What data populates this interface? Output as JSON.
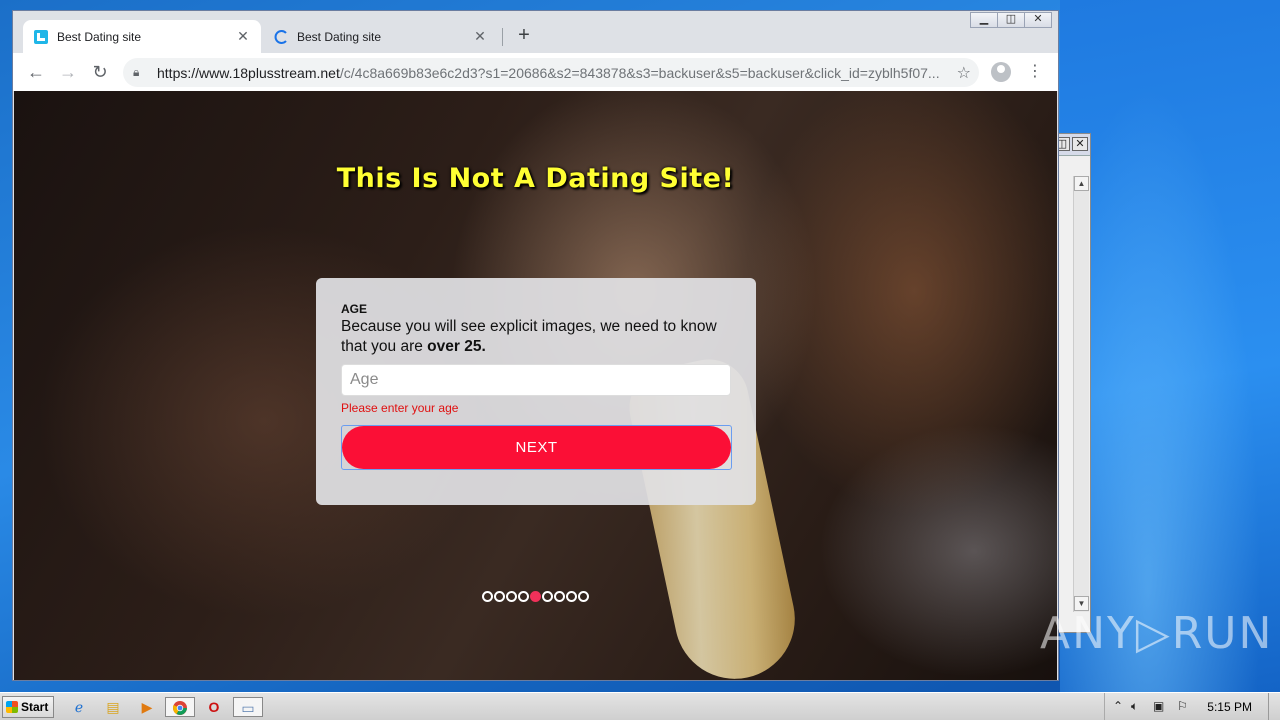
{
  "browser": {
    "tabs": [
      {
        "title": "Best Dating site",
        "active": true,
        "favicon": "site-logo-icon"
      },
      {
        "title": "Best Dating site",
        "active": false,
        "favicon": "loading-spinner-icon"
      }
    ],
    "url_host": "https://www.18plusstream.net",
    "url_path": "/c/4c8a669b83e6c2d3?s1=20686&s2=843878&s3=backuser&s5=backuser&click_id=zyblh5f07..."
  },
  "page": {
    "headline": "This Is Not A Dating Site!",
    "form": {
      "label": "AGE",
      "description_pre": "Because you will see explicit images, we need to know that you are ",
      "description_bold": "over 25.",
      "input_placeholder": "Age",
      "input_value": "",
      "error": "Please enter your age",
      "next_label": "NEXT"
    },
    "progress": {
      "total_steps": 9,
      "current_step": 5
    }
  },
  "watermark": "ANY▷RUN",
  "taskbar": {
    "start_label": "Start",
    "clock": "5:15 PM"
  },
  "colors": {
    "headline": "#ffff33",
    "next_button": "#fb0f36",
    "error": "#e01010",
    "active_dot": "#f0315a"
  }
}
